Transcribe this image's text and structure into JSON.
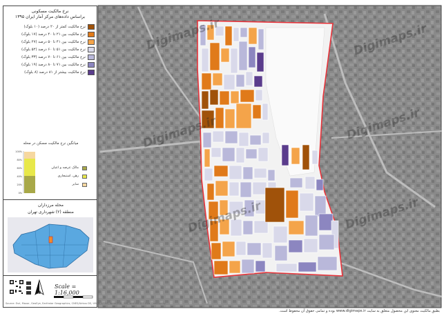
{
  "legend": {
    "title_line1": "نرخ مالکیت مسکونی",
    "title_line2": "براساس داده‌های مرکز آمار ایران ۱۳۹۵",
    "items": [
      {
        "label": "نرخ مالکیت کمتر از ۲۰ درصد (۱۰ بلوک)",
        "color": "#a0520a"
      },
      {
        "label": "نرخ مالکیت بین ۲۱ تا ۴۰ درصد (۱۷ بلوک)",
        "color": "#e07a1a"
      },
      {
        "label": "نرخ مالکیت بین ۴۱ تا ۵۰ درصد (۲۷ بلوک)",
        "color": "#f4a44a"
      },
      {
        "label": "نرخ مالکیت بین ۵۱ تا ۶۰ درصد (۵۲ بلوک)",
        "color": "#d9d9ea"
      },
      {
        "label": "نرخ مالکیت بین ۶۱ تا ۷۰ درصد (۳۳ بلوک)",
        "color": "#b9b8da"
      },
      {
        "label": "نرخ مالکیت بین ۷۱ تا ۸۰ درصد (۱۹ بلوک)",
        "color": "#8c86c0"
      },
      {
        "label": "نرخ مالکیت بیشتر از ۸۱ درصد (۸ بلوک)",
        "color": "#5a3c8c"
      }
    ]
  },
  "bar_chart": {
    "title": "میانگین نرخ مالکیت مسکن در محله",
    "legend": [
      {
        "label": "مالک عرصه و اعیان",
        "color": "#a8a848"
      },
      {
        "label": "رهن، استیجاری",
        "color": "#e8e84a"
      },
      {
        "label": "سایر",
        "color": "#f6d8a0"
      }
    ],
    "ticks": [
      "100%",
      "80%",
      "60%",
      "40%",
      "20%",
      "0%"
    ]
  },
  "locator": {
    "title_line1": "محله مرزداران",
    "title_line2": "منطقه (۲) شهرداری تهران"
  },
  "scale": {
    "text": "Scale = 1:16,000"
  },
  "north": {
    "text": "N"
  },
  "footer": {
    "note": "بطبق مالکیت معنوی این محصول متعلق به سایت www.digimaps.ir بوده و تمامی حقوق آن محفوظ است.",
    "credits": "Source: Esri, Maxar, GeoEye, Earthstar Geographics, CNES/Airbus DS, USDA, USGS, AeroGRID, IGN, and the GIS User Community"
  },
  "watermark": {
    "text": "Digimaps.ir"
  },
  "colors": {
    "boundary": "#e8333a",
    "basemap": "#8c8c8c",
    "street": "#b8b8b8"
  }
}
